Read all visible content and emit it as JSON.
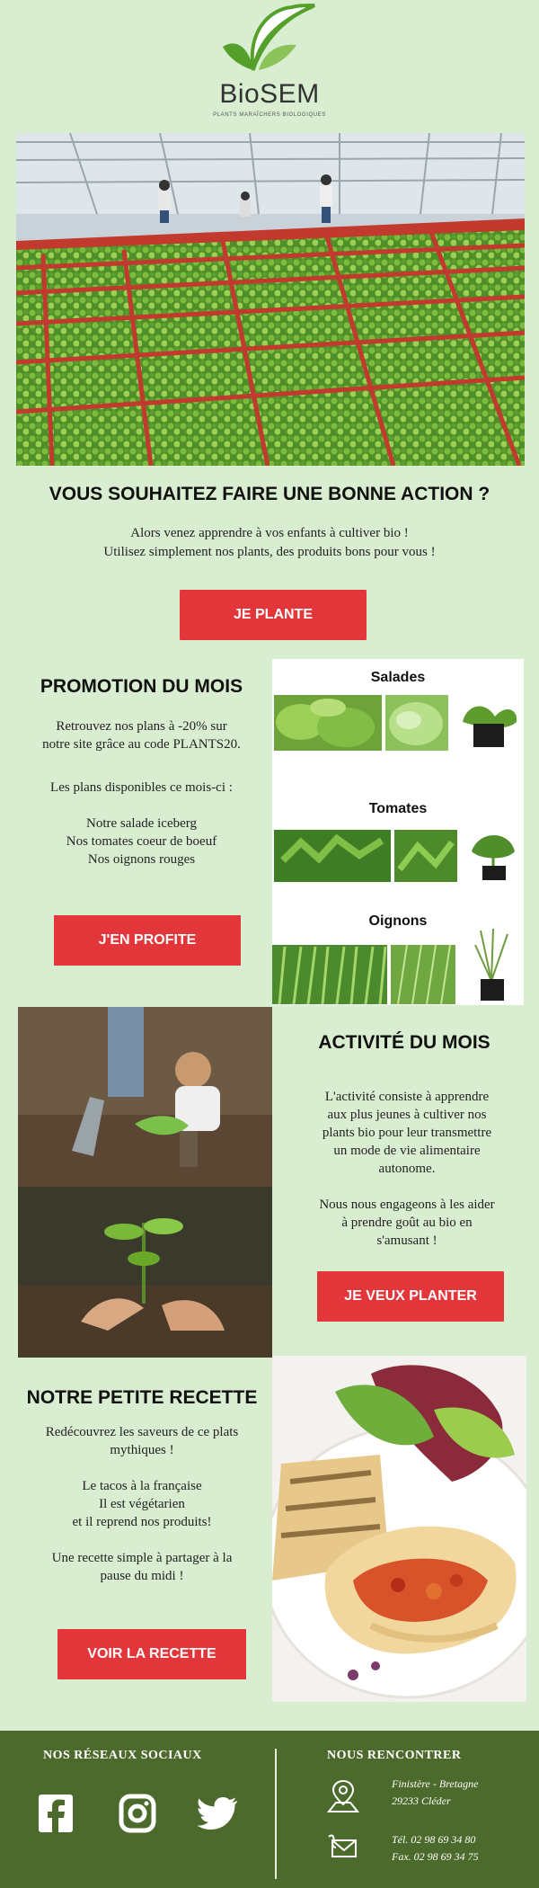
{
  "header": {
    "brand_name": "BioSEM",
    "brand_tagline": "PLANTS MARAÎCHERS BIOLOGIQUES",
    "logo_icon": "leaf-logo-icon",
    "colors": {
      "leaf_green": "#55a02b",
      "leaf_light": "#8cc25a"
    }
  },
  "hero": {
    "image": "greenhouse-seedlings-image",
    "title": "VOUS SOUHAITEZ FAIRE UNE BONNE ACTION ?",
    "line1": "Alors venez apprendre à vos enfants à cultiver bio !",
    "line2": "Utilisez simplement nos plants, des produits bons pour vous !",
    "button": "JE PLANTE"
  },
  "promo": {
    "title": "PROMOTION DU MOIS",
    "line1": "Retrouvez nos plans à -20% sur",
    "line2": "notre site grâce au code PLANTS20.",
    "available": "Les plans disponibles ce mois-ci :",
    "items": [
      "Notre salade iceberg",
      "Nos tomates coeur de boeuf",
      "Nos oignons rouges"
    ],
    "button": "J'EN PROFITE",
    "categories": [
      "Salades",
      "Tomates",
      "Oignons"
    ]
  },
  "activity": {
    "title": "ACTIVITÉ DU MOIS",
    "p1": [
      "L'activité consiste à apprendre",
      "aux plus jeunes à cultiver nos",
      "plants bio pour leur transmettre",
      "un mode de vie alimentaire",
      "autonome."
    ],
    "p2": [
      "Nous nous engageons à les aider",
      "à prendre goût au bio en",
      "s'amusant !"
    ],
    "button": "JE VEUX PLANTER"
  },
  "recipe": {
    "title": "NOTRE PETITE RECETTE",
    "p1": [
      "Redécouvrez les saveurs de ce plats",
      "mythiques !"
    ],
    "p2": [
      "Le tacos à la française",
      "Il est végétarien",
      "et il reprend nos produits!"
    ],
    "p3": [
      "Une recette simple à partager à la",
      "pause du midi !"
    ],
    "button": "VOIR LA RECETTE"
  },
  "footer": {
    "social_title": "NOS RÉSEAUX SOCIAUX",
    "social_icons": [
      "facebook-icon",
      "instagram-icon",
      "twitter-icon"
    ],
    "meet_title": "NOUS RENCONTRER",
    "address1": "Finistère - Bretagne",
    "address2": "29233 Cléder",
    "phone": "Tél. 02 98 69 34 80",
    "fax": "Fax. 02 98 69 34 75",
    "bg_color": "#4c6a2c",
    "button_color": "#e3363a"
  }
}
